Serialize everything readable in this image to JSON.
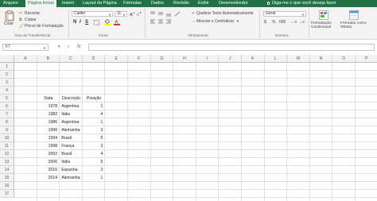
{
  "ribbon_tabs": [
    "Arquivo",
    "Página Inicial",
    "Inserir",
    "Layout da Página",
    "Fórmulas",
    "Dados",
    "Revisão",
    "Exibir",
    "Desenvolvedor"
  ],
  "tell_me": "Diga-me o que você deseja fazer",
  "clipboard": {
    "paste": "Colar",
    "cut": "Recortar",
    "copy": "Copiar",
    "format_painter": "Pincel de Formatação",
    "group": "Área de Transferência"
  },
  "font": {
    "name": "Calibri",
    "size": "11",
    "bold": "N",
    "italic": "I",
    "underline": "S",
    "group": "Fonte"
  },
  "alignment": {
    "wrap": "Quebrar Texto Automaticamente",
    "merge": "Mesclar e Centralizar",
    "group": "Alinhamento"
  },
  "number": {
    "format": "Geral",
    "currency": "$",
    "percent": "%",
    "thousands": "000",
    "group": "Número"
  },
  "styles": {
    "conditional": "Formatação Condicional",
    "table": "Formatar como Tabela"
  },
  "formula_bar": {
    "name_box": "F7",
    "fx": "fx",
    "value": ""
  },
  "accent_color": "#217346",
  "columns": [
    "A",
    "B",
    "C",
    "D",
    "E",
    "F",
    "G",
    "H",
    "I",
    "J",
    "K",
    "L",
    "M",
    "N",
    "O",
    "P",
    "Q"
  ],
  "rows": [
    "1",
    "2",
    "3",
    "4",
    "5",
    "6",
    "7",
    "8",
    "9",
    "10",
    "11",
    "12",
    "13",
    "14",
    "15",
    "16",
    "17"
  ],
  "table": {
    "headers": [
      "Data",
      "Descrição",
      "Posição"
    ],
    "rows": [
      [
        "1978",
        "Argentina",
        "1"
      ],
      [
        "1982",
        "Itália",
        "4"
      ],
      [
        "1986",
        "Argentina",
        "1"
      ],
      [
        "1990",
        "Alemanha",
        "3"
      ],
      [
        "1994",
        "Brasil",
        "5"
      ],
      [
        "1998",
        "França",
        "3"
      ],
      [
        "2002",
        "Brasil",
        "4"
      ],
      [
        "2006",
        "Itália",
        "5"
      ],
      [
        "2010",
        "Espanha",
        "3"
      ],
      [
        "2014",
        "Alemanha",
        "1"
      ]
    ]
  }
}
